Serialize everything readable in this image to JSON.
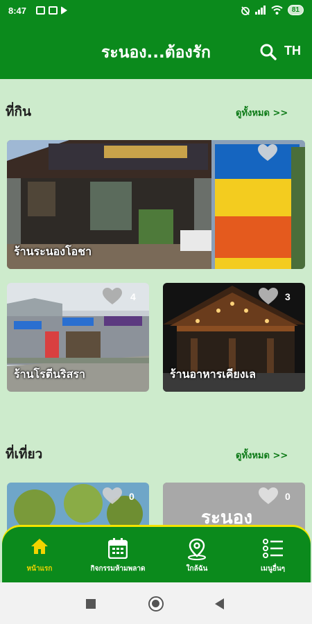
{
  "status": {
    "time": "8:47",
    "battery": "81"
  },
  "appbar": {
    "title": "ระนอง...ต้องรัก",
    "lang": "TH"
  },
  "eat": {
    "title": "ที่กิน",
    "see_all": "ดูทั้งหมด >>",
    "featured": {
      "name": "ร้านระนองโอชา",
      "count": ""
    },
    "cards": [
      {
        "name": "ร้านโรตีนริสรา",
        "count": "4"
      },
      {
        "name": "ร้านอาหารเคียงเล",
        "count": "3"
      }
    ]
  },
  "travel": {
    "title": "ที่เที่ยว",
    "see_all": "ดูทั้งหมด >>",
    "cards": [
      {
        "name": "",
        "count": "0"
      },
      {
        "name": "",
        "count": "0",
        "sign_text": "ระนอง"
      }
    ]
  },
  "nav": [
    {
      "label": "หน้าแรก",
      "icon": "home-icon",
      "active": true
    },
    {
      "label": "กิจกรรมห้ามพลาด",
      "icon": "calendar-icon",
      "active": false
    },
    {
      "label": "ใกล้ฉัน",
      "icon": "location-pin-icon",
      "active": false
    },
    {
      "label": "เมนูอื่นๆ",
      "icon": "list-menu-icon",
      "active": false
    }
  ],
  "colors": {
    "primary": "#0b8a1c",
    "background": "#cdebcc",
    "active_nav": "#f2d400",
    "nav_border": "#f3e400"
  }
}
